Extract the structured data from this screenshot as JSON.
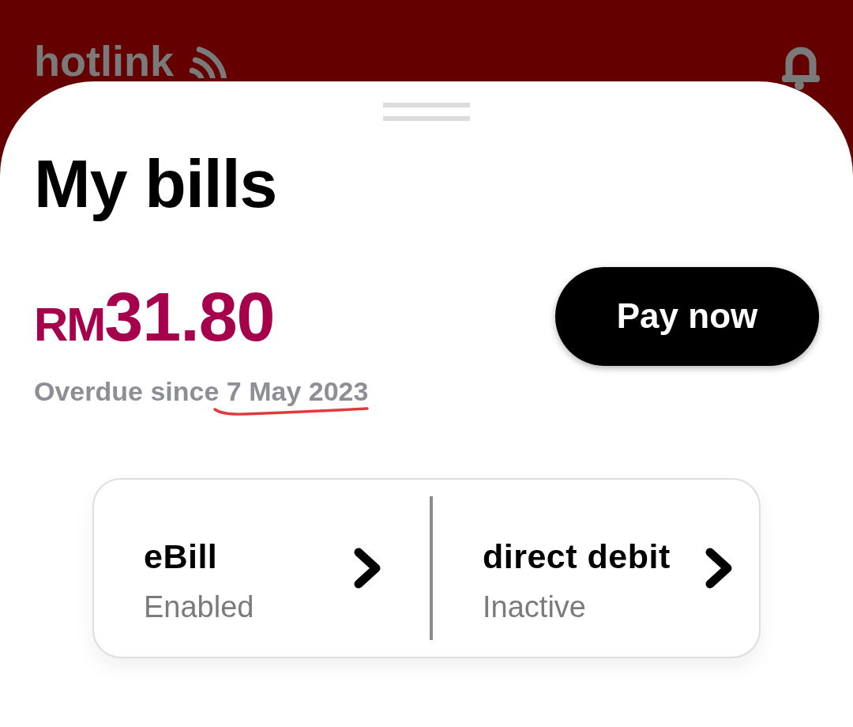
{
  "header": {
    "logo_text": "hotlink"
  },
  "sheet": {
    "title": "My bills"
  },
  "bill": {
    "currency": "RM",
    "amount": "31.80",
    "status_text": "Overdue since",
    "due_date": "7 May 2023",
    "due_date_underlined": true,
    "pay_button": "Pay now"
  },
  "options": [
    {
      "title": "eBill",
      "status": "Enabled"
    },
    {
      "title": "direct debit",
      "status": "Inactive"
    }
  ]
}
